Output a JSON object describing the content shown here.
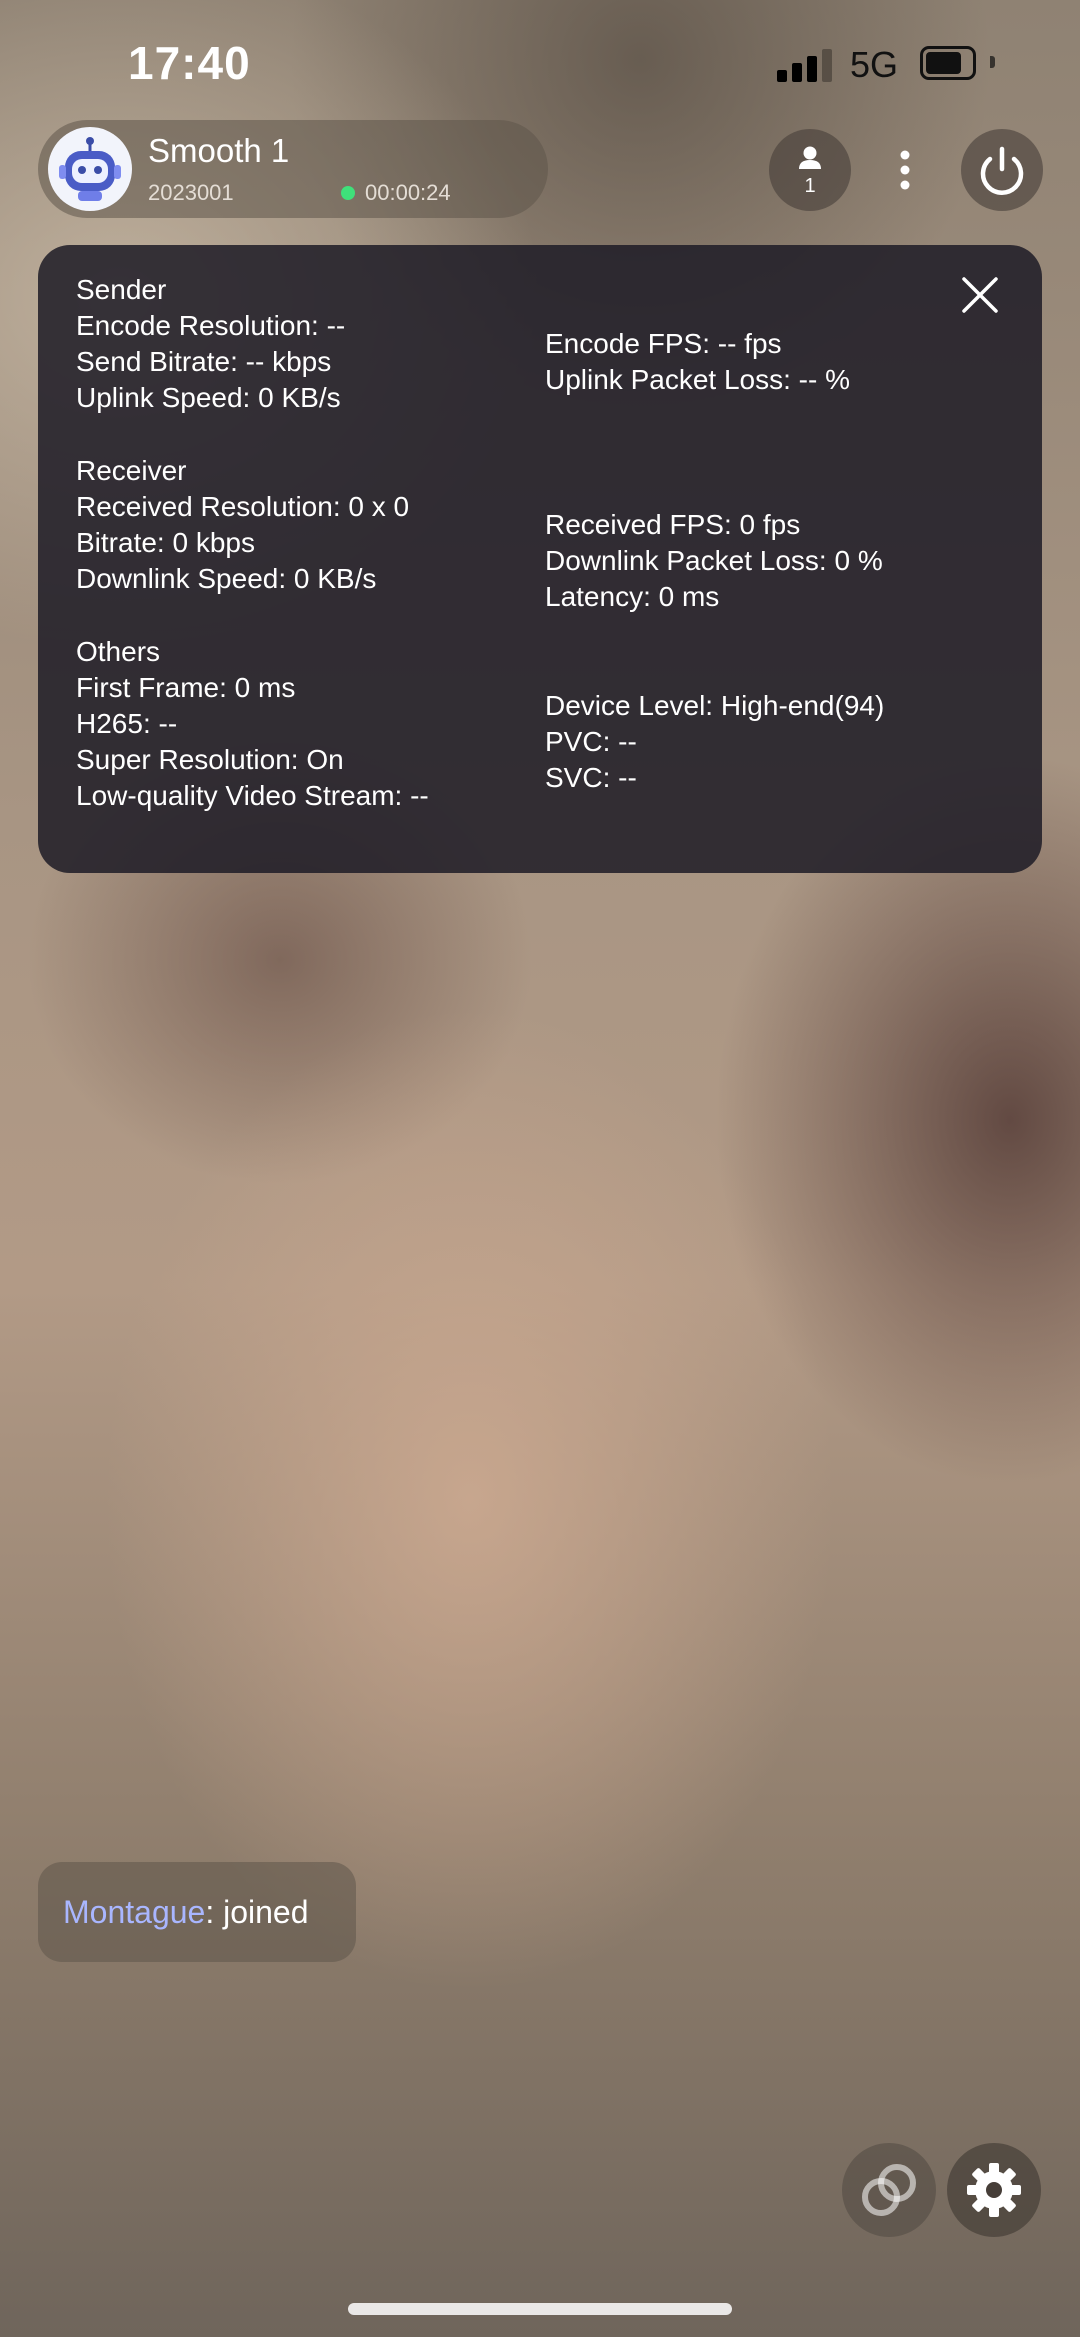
{
  "status_bar": {
    "time": "17:40",
    "network": "5G",
    "battery_level": 0.8,
    "signal_bars": 3
  },
  "room": {
    "title": "Smooth 1",
    "id": "2023001",
    "duration": "00:00:24",
    "live_status_color": "#3fe07a"
  },
  "toolbar": {
    "user_count": "1"
  },
  "stats": {
    "sender": {
      "heading": "Sender",
      "encode_resolution": "Encode Resolution: --",
      "send_bitrate": "Send Bitrate: -- kbps",
      "uplink_speed": "Uplink Speed: 0 KB/s",
      "encode_fps": "Encode FPS: -- fps",
      "uplink_packet_loss": "Uplink Packet Loss: -- %"
    },
    "receiver": {
      "heading": "Receiver",
      "received_resolution": "Received Resolution: 0 x 0",
      "bitrate": "Bitrate: 0 kbps",
      "downlink_speed": "Downlink Speed: 0 KB/s",
      "received_fps": "Received FPS: 0 fps",
      "downlink_packet_loss": "Downlink Packet Loss: 0 %",
      "latency": "Latency: 0 ms"
    },
    "others": {
      "heading": "Others",
      "first_frame": "First Frame: 0 ms",
      "h265": "H265: --",
      "super_resolution": "Super Resolution: On",
      "low_quality_stream": "Low-quality Video Stream: --",
      "device_level": "Device Level: High-end(94)",
      "pvc": "PVC: --",
      "svc": "SVC: --"
    }
  },
  "toast": {
    "user": "Montague",
    "message": ": joined"
  },
  "colors": {
    "accent_user": "#a9b6ff",
    "panel_bg": "#1e1c26"
  }
}
